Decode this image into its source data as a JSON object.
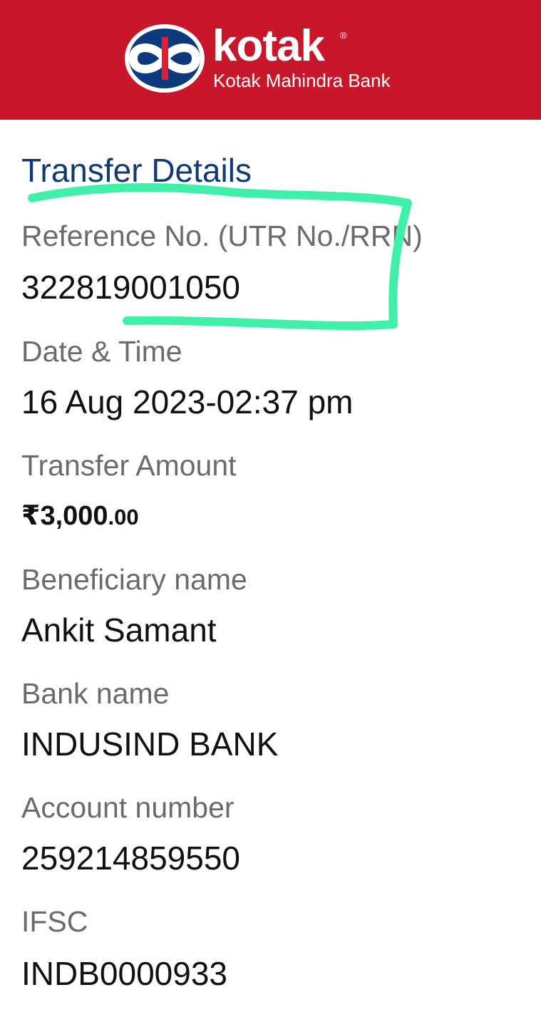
{
  "header": {
    "brand": "kotak",
    "registered_mark": "®",
    "bank_full_name": "Kotak Mahindra Bank",
    "logo_icon": "kotak-infinity-logo",
    "background_color": "#c8162a"
  },
  "section": {
    "title": "Transfer Details"
  },
  "details": {
    "reference": {
      "label": "Reference No. (UTR No./RRN)",
      "value": "322819001050"
    },
    "datetime": {
      "label": "Date & Time",
      "value": "16 Aug 2023-02:37 pm"
    },
    "amount": {
      "label": "Transfer Amount",
      "rupees": "₹3,000",
      "paise": ".00"
    },
    "beneficiary": {
      "label": "Beneficiary name",
      "value": "Ankit Samant"
    },
    "bank": {
      "label": "Bank name",
      "value": "INDUSIND BANK"
    },
    "account": {
      "label": "Account number",
      "value": "259214859550"
    },
    "ifsc": {
      "label": "IFSC",
      "value": "INDB0000933"
    }
  },
  "annotation": {
    "color": "#3ef0a8",
    "icon": "hand-drawn-highlight-box"
  }
}
